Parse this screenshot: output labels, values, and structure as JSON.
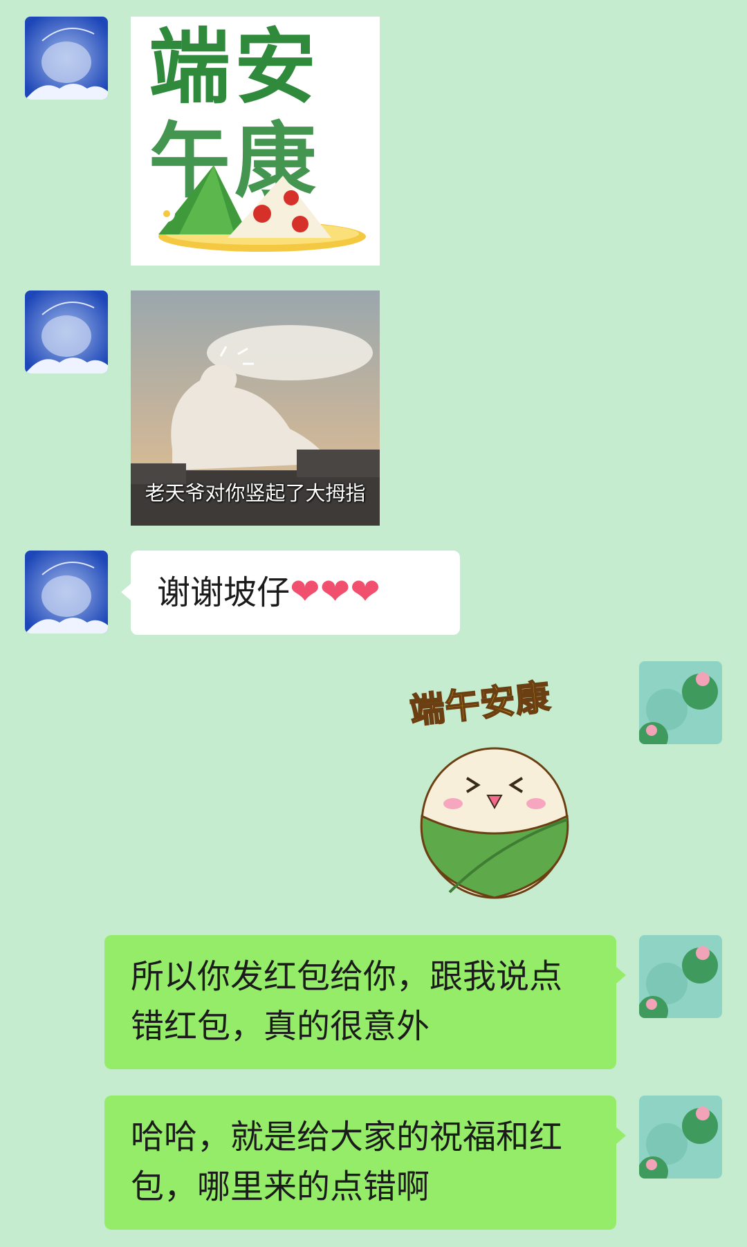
{
  "messages": {
    "m1": {
      "sender": "other",
      "type": "image",
      "title_line1": "端安",
      "title_line2": "午康"
    },
    "m2": {
      "sender": "other",
      "type": "image",
      "caption": "老天爷对你竖起了大拇指"
    },
    "m3": {
      "sender": "other",
      "type": "text",
      "text": "谢谢坡仔",
      "emoji": [
        "❤",
        "❤",
        "❤"
      ]
    },
    "m4": {
      "sender": "self",
      "type": "sticker",
      "sticker_text": "端午安康"
    },
    "m5": {
      "sender": "self",
      "type": "text",
      "line1": "所以你发红包给你，跟我说点",
      "line2": "错红包，真的很意外"
    },
    "m6": {
      "sender": "self",
      "type": "text",
      "line1": "哈哈，就是给大家的祝福和红",
      "line2": "包，哪里来的点错啊"
    }
  },
  "colors": {
    "background": "#c6eccf",
    "bubble_other": "#ffffff",
    "bubble_self": "#95ec69",
    "heart": "#f0506e"
  },
  "icons": {
    "avatar_other": "blue-cloud-avatar",
    "avatar_self": "lotus-pond-avatar"
  }
}
